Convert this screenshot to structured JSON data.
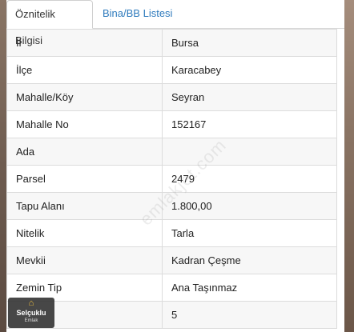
{
  "tabs": [
    {
      "label": "Öznitelik Bilgisi",
      "active": true
    },
    {
      "label": "Bina/BB Listesi",
      "active": false
    }
  ],
  "rows": [
    {
      "key": "İl",
      "value": "Bursa"
    },
    {
      "key": "İlçe",
      "value": "Karacabey"
    },
    {
      "key": "Mahalle/Köy",
      "value": "Seyran"
    },
    {
      "key": "Mahalle No",
      "value": "152167"
    },
    {
      "key": "Ada",
      "value": ""
    },
    {
      "key": "Parsel",
      "value": "2479"
    },
    {
      "key": "Tapu Alanı",
      "value": "1.800,00"
    },
    {
      "key": "Nitelik",
      "value": "Tarla"
    },
    {
      "key": "Mevkii",
      "value": "Kadran Çeşme"
    },
    {
      "key": "Zemin Tip",
      "value": "Ana Taşınmaz"
    },
    {
      "key": "",
      "value": "5"
    }
  ],
  "watermark": "emlakjet.com",
  "logo": {
    "name": "Selçuklu",
    "sub": "Emlak"
  },
  "colors": {
    "tab_link": "#2f7bbd",
    "row_odd": "#f7f7f7",
    "border": "#dcdcdc"
  }
}
